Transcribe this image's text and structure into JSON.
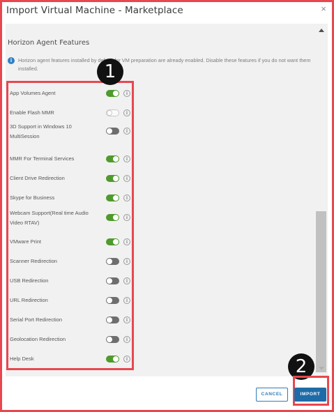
{
  "dialog": {
    "title": "Import Virtual Machine - Marketplace",
    "close_glyph": "×"
  },
  "section": {
    "title": "Horizon Agent Features",
    "info_glyph": "i",
    "info_text": "Horizon agent features installed by default for VM preparation are already enabled. Disable these features if you do not want them installed."
  },
  "features": [
    {
      "label": "App Volumes Agent",
      "state": "on"
    },
    {
      "label": "Enable Flash MMR",
      "state": "off-disabled"
    },
    {
      "label": "3D Support in Windows 10 MultiSession",
      "state": "off"
    },
    {
      "label": "MMR For Terminal Services",
      "state": "on"
    },
    {
      "label": "Client Drive Redirection",
      "state": "on"
    },
    {
      "label": "Skype for Business",
      "state": "on"
    },
    {
      "label": "Webcam Support(Real time Audio Video RTAV)",
      "state": "on"
    },
    {
      "label": "VMware Print",
      "state": "on"
    },
    {
      "label": "Scanner Redirection",
      "state": "off"
    },
    {
      "label": "USB Redirection",
      "state": "off"
    },
    {
      "label": "URL Redirection",
      "state": "off"
    },
    {
      "label": "Serial Port Redirection",
      "state": "off"
    },
    {
      "label": "Geolocation Redirection",
      "state": "off"
    },
    {
      "label": "Help Desk",
      "state": "on"
    }
  ],
  "help_glyph": "i",
  "annotations": {
    "badge_1": "1",
    "badge_2": "2"
  },
  "footer": {
    "cancel_label": "CANCEL",
    "import_label": "IMPORT"
  },
  "colors": {
    "toggle_on": "#4f9a2c",
    "toggle_off": "#6e6e6e",
    "highlight": "#e8474f",
    "primary": "#1f6ba8"
  }
}
